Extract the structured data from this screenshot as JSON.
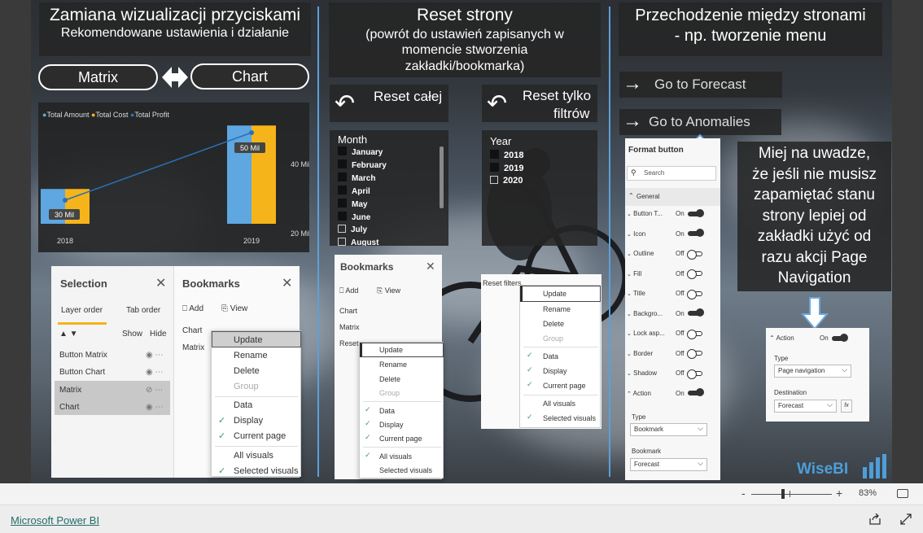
{
  "col1": {
    "title": "Zamiana wizualizacji przyciskami",
    "subtitle": "Rekomendowane ustawienia i działanie",
    "btn_matrix": "Matrix",
    "btn_chart": "Chart",
    "legend": [
      "Total Amount",
      "Total Cost",
      "Total Profit"
    ],
    "selection": {
      "title": "Selection",
      "tab_layer": "Layer order",
      "tab_tab": "Tab order",
      "show": "Show",
      "hide": "Hide",
      "items": [
        "Button Matrix",
        "Button Chart",
        "Matrix",
        "Chart"
      ]
    },
    "bookmarks": {
      "title": "Bookmarks",
      "add": "Add",
      "view": "View",
      "items": [
        "Chart",
        "Matrix"
      ],
      "menu": [
        "Update",
        "Rename",
        "Delete",
        "Group",
        "Data",
        "Display",
        "Current page",
        "All visuals",
        "Selected visuals"
      ]
    }
  },
  "chart_data": {
    "type": "bar",
    "categories": [
      "2018",
      "2019"
    ],
    "series": [
      {
        "name": "Total Amount",
        "values": [
          30,
          50
        ]
      },
      {
        "name": "Total Cost",
        "values": [
          30,
          50
        ]
      },
      {
        "name": "Total Profit",
        "values": [
          30,
          50
        ]
      }
    ],
    "data_labels": [
      "30 Mil",
      "50 Mil"
    ],
    "ytick_labels": [
      "40 Mil",
      "20 Mil"
    ],
    "colors": [
      "#5ea7e0",
      "#f5b41a",
      "#2b6fb8"
    ]
  },
  "col2": {
    "title": "Reset strony",
    "subtitle1": "(powrót do ustawień zapisanych w",
    "subtitle2": "momencie stworzenia",
    "subtitle3": "zakładki/bookmarka)",
    "reset_all": "Reset całej",
    "reset_filters1": "Reset tylko",
    "reset_filters2": "filtrów",
    "month_title": "Month",
    "months": [
      "January",
      "February",
      "March",
      "April",
      "May",
      "June",
      "July",
      "August"
    ],
    "year_title": "Year",
    "years": [
      "2018",
      "2019",
      "2020"
    ],
    "bookmarks": {
      "title": "Bookmarks",
      "add": "Add",
      "view": "View",
      "items": [
        "Chart",
        "Matrix",
        "Reset"
      ],
      "menu": [
        "Update",
        "Rename",
        "Delete",
        "Group",
        "Data",
        "Display",
        "Current page",
        "All visuals",
        "Selected visuals"
      ]
    },
    "reset_filters_label": "Reset filters",
    "menu2": [
      "Update",
      "Rename",
      "Delete",
      "Group",
      "Data",
      "Display",
      "Current page",
      "All visuals",
      "Selected visuals"
    ]
  },
  "col3": {
    "title1": "Przechodzenie między stronami",
    "title2": "- np. tworzenie menu",
    "go_forecast": "Go to Forecast",
    "go_anomalies": "Go to Anomalies",
    "format": {
      "title": "Format button",
      "search": "Search",
      "general": "General",
      "rows": [
        [
          "Button T...",
          "On"
        ],
        [
          "Icon",
          "On"
        ],
        [
          "Outline",
          "Off"
        ],
        [
          "Fill",
          "Off"
        ],
        [
          "Title",
          "Off"
        ],
        [
          "Backgro...",
          "On"
        ],
        [
          "Lock asp...",
          "Off"
        ],
        [
          "Border",
          "Off"
        ],
        [
          "Shadow",
          "Off"
        ],
        [
          "Action",
          "On"
        ]
      ],
      "type_label": "Type",
      "type_value": "Bookmark",
      "bookmark_label": "Bookmark",
      "bookmark_value": "Forecast"
    },
    "note": [
      "Miej na uwadze,",
      "że jeśli nie musisz",
      "zapamiętać stanu",
      "strony lepiej od",
      "zakładki użyć od",
      "razu akcji Page",
      "Navigation"
    ],
    "action": {
      "label": "Action",
      "state": "On",
      "type_label": "Type",
      "type_value": "Page navigation",
      "dest_label": "Destination",
      "dest_value": "Forecast",
      "fx": "fx"
    },
    "logo": "WiseBI"
  },
  "footer": {
    "zoom": "83%",
    "minus": "-",
    "plus": "+",
    "brand": "Microsoft Power BI"
  }
}
